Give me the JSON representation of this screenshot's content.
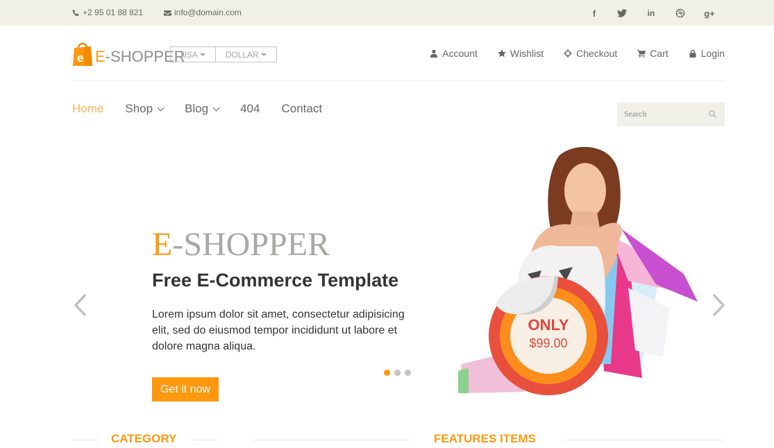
{
  "topbar": {
    "phone": "+2 95 01 88 821",
    "email": "info@domain.com",
    "social": [
      {
        "icon": "facebook-icon",
        "glyph": "f"
      },
      {
        "icon": "twitter-icon"
      },
      {
        "icon": "linkedin-icon",
        "glyph": "in"
      },
      {
        "icon": "dribbble-icon"
      },
      {
        "icon": "google-plus-icon",
        "glyph": "g+"
      }
    ]
  },
  "header": {
    "logo": {
      "first": "E",
      "rest": "-SHOPPER"
    },
    "country": "USA",
    "currency": "DOLLAR",
    "usernav": [
      {
        "label": "Account",
        "icon": "user-icon"
      },
      {
        "label": "Wishlist",
        "icon": "star-icon"
      },
      {
        "label": "Checkout",
        "icon": "crosshairs-icon"
      },
      {
        "label": "Cart",
        "icon": "cart-icon"
      },
      {
        "label": "Login",
        "icon": "lock-icon"
      }
    ]
  },
  "nav": {
    "items": [
      {
        "label": "Home",
        "active": true
      },
      {
        "label": "Shop",
        "dropdown": true
      },
      {
        "label": "Blog",
        "dropdown": true
      },
      {
        "label": "404"
      },
      {
        "label": "Contact"
      }
    ],
    "search_placeholder": "Search"
  },
  "slider": {
    "title_first": "E",
    "title_rest": "-SHOPPER",
    "subtitle": "Free E-Commerce Template",
    "description": "Lorem ipsum dolor sit amet, consectetur adipisicing elit, sed do eiusmod tempor incididunt ut labore et dolore magna aliqua.",
    "cta": "Get it now",
    "badge_label": "ONLY",
    "badge_price": "$99.00",
    "slides": 3,
    "active_slide": 1
  },
  "sections": {
    "category": "CATEGORY",
    "features": "FEATURES ITEMS"
  },
  "colors": {
    "accent": "#fe980f",
    "topbar_bg": "#f0f0e9",
    "text": "#696763",
    "dark_text": "#363432",
    "badge_red": "#e0473b"
  }
}
